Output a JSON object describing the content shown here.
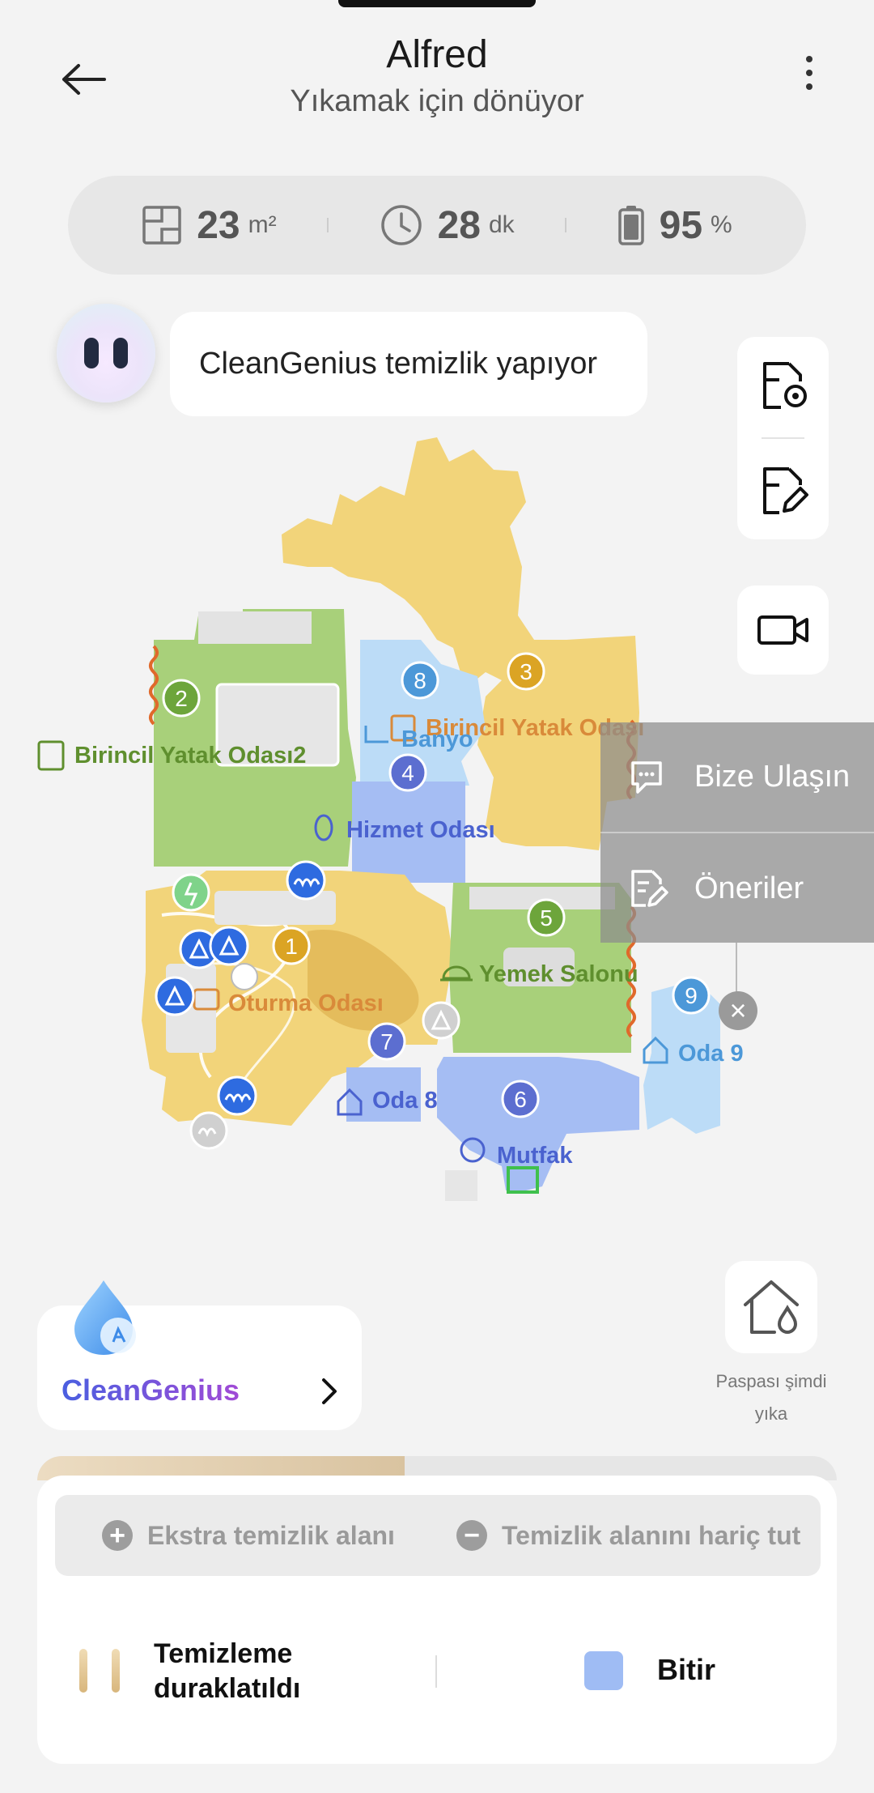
{
  "header": {
    "title": "Alfred",
    "subtitle": "Yıkamak için dönüyor"
  },
  "stats": {
    "area_value": "23",
    "area_unit": "m²",
    "time_value": "28",
    "time_unit": "dk",
    "battery_value": "95",
    "battery_unit": "%"
  },
  "assistant": {
    "message": "CleanGenius temizlik yapıyor"
  },
  "overlay_menu": {
    "contact_label": "Bize Ulaşın",
    "suggestions_label": "Öneriler"
  },
  "map": {
    "rooms": [
      {
        "number": "1",
        "name": "Oturma Odası",
        "color": "#f2d47a"
      },
      {
        "number": "2",
        "name": "Birincil Yatak Odası2",
        "color": "#a8d07a"
      },
      {
        "number": "3",
        "name": "Birincil Yatak Odası",
        "color": "#f2d47a"
      },
      {
        "number": "4",
        "name": "Hizmet Odası",
        "color": "#a5bdf3"
      },
      {
        "number": "5",
        "name": "Yemek Salonu",
        "color": "#a8d07a"
      },
      {
        "number": "6",
        "name": "Mutfak",
        "color": "#a5bdf3"
      },
      {
        "number": "7",
        "name": "Oda 8",
        "color": "#a5bdf3"
      },
      {
        "number": "8",
        "name": "Banyo",
        "color": "#bcdcf7"
      },
      {
        "number": "9",
        "name": "Oda 9",
        "color": "#bcdcf7"
      }
    ]
  },
  "clean_genius": {
    "label": "CleanGenius"
  },
  "wash_mop": {
    "label_line1": "Paspası şimdi",
    "label_line2": "yıka"
  },
  "progress": {
    "fraction": 0.46
  },
  "area_actions": {
    "add_label": "Ekstra temizlik alanı",
    "exclude_label": "Temizlik alanını hariç tut"
  },
  "controls": {
    "pause_line1": "Temizleme",
    "pause_line2": "duraklatıldı",
    "finish_label": "Bitir"
  },
  "colors": {
    "yellow_room": "#f2d47a",
    "green_room": "#a8d07a",
    "blue_room": "#a5bdf3",
    "light_blue_room": "#bcdcf7",
    "orange_label": "#d98a3a",
    "green_label": "#5f8f2e",
    "blue_label": "#4a62cf",
    "accent_gradient_start": "#4a5fe0",
    "accent_gradient_end": "#a14ad6"
  }
}
